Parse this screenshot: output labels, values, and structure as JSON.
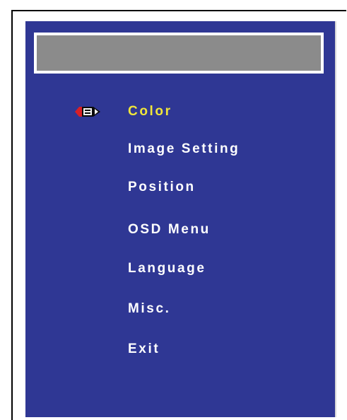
{
  "colors": {
    "panel_bg": "#2f3794",
    "title_bar": "#8b8b8b",
    "selected_text": "#f0e63a",
    "text": "#ffffff"
  },
  "menu": {
    "selected_index": 0,
    "selector_icon": "pencil-pointer-icon",
    "items": [
      {
        "label": "Color"
      },
      {
        "label": "Image Setting"
      },
      {
        "label": "Position"
      },
      {
        "label": "OSD Menu"
      },
      {
        "label": "Language"
      },
      {
        "label": "Misc."
      },
      {
        "label": "Exit"
      }
    ]
  }
}
